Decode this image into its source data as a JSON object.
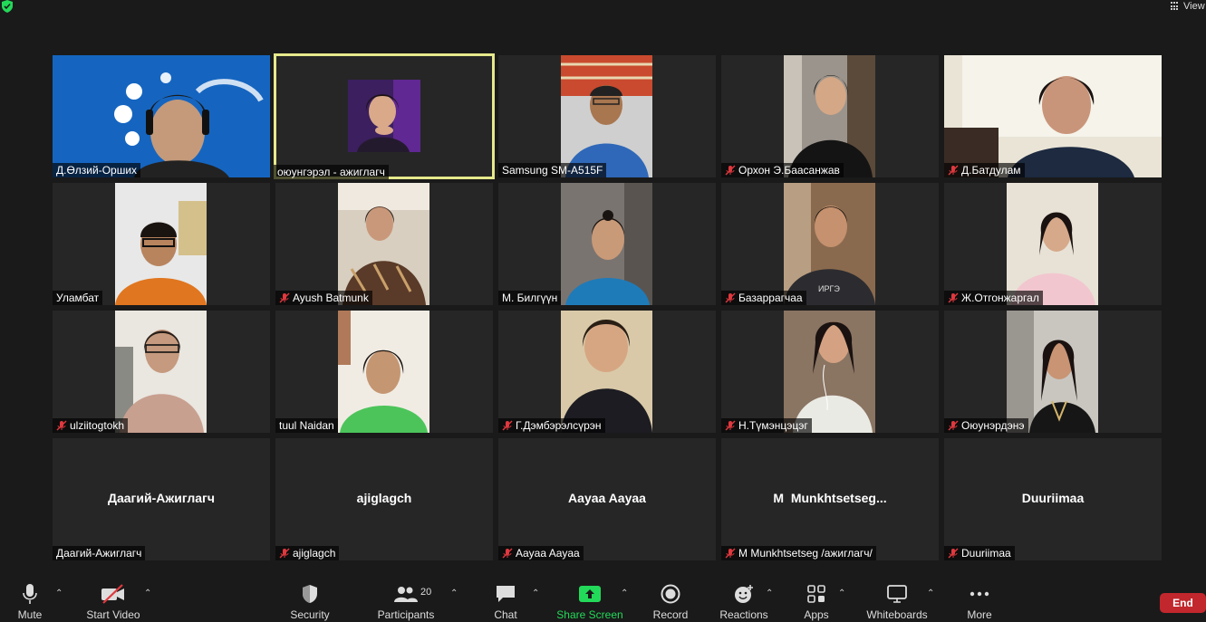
{
  "top": {
    "view_label": "View"
  },
  "participants": [
    {
      "name": "Д.Өлзий-Орших",
      "muted": false
    },
    {
      "name": "оюунгэрэл - ажиглагч",
      "muted": false
    },
    {
      "name": "Samsung SM-A515F",
      "muted": false
    },
    {
      "name": "Орхон Э.Баасанжав",
      "muted": true
    },
    {
      "name": "Д.Батдулам",
      "muted": true
    },
    {
      "name": "Уламбат",
      "muted": false
    },
    {
      "name": "Ayush Batmunk",
      "muted": true
    },
    {
      "name": "М. Билгүүн",
      "muted": false
    },
    {
      "name": "Базаррагчаа",
      "muted": true
    },
    {
      "name": "Ж.Отгонжаргал",
      "muted": true
    },
    {
      "name": "ulziitogtokh",
      "muted": true
    },
    {
      "name": "tuul Naidan",
      "muted": false
    },
    {
      "name": "Г.Дэмбэрэлсүрэн",
      "muted": true
    },
    {
      "name": "Н.Түмэнцэцэг",
      "muted": true
    },
    {
      "name": "Оюунэрдэнэ",
      "muted": true
    },
    {
      "name": "Даагий-Ажиглагч",
      "display": "Даагий-Ажиглагч",
      "muted": false
    },
    {
      "name": "ajiglagch",
      "display": "ajiglagch",
      "muted": true
    },
    {
      "name": "Aayaa Aayaa",
      "display": "Aayaa Aayaa",
      "muted": true
    },
    {
      "name": "M Munkhtsetseg /ажиглагч/",
      "display": "M  Munkhtsetseg...",
      "muted": true
    },
    {
      "name": "Duuriimaa",
      "display": "Duuriimaa",
      "muted": true
    }
  ],
  "toolbar": {
    "mute": "Mute",
    "start_video": "Start Video",
    "security": "Security",
    "participants": "Participants",
    "participants_count": "20",
    "chat": "Chat",
    "share_screen": "Share Screen",
    "record": "Record",
    "reactions": "Reactions",
    "apps": "Apps",
    "whiteboards": "Whiteboards",
    "more": "More",
    "end": "End"
  },
  "colors": {
    "share_green": "#23d959",
    "end_red": "#c1272d",
    "active_speaker": "#e6e98b",
    "muted_red": "#e0383e"
  }
}
